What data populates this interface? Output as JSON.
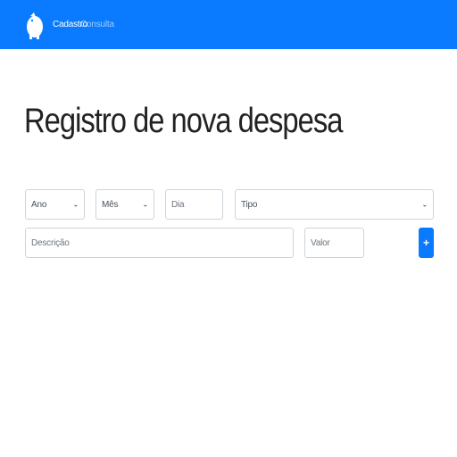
{
  "navbar": {
    "brand_icon": "piggy-bank-icon",
    "links": [
      {
        "label": "Cadastro",
        "active": true
      },
      {
        "label": "Consulta",
        "active": false
      }
    ],
    "background": "#0a7bff"
  },
  "main": {
    "title": "Registro de nova despesa"
  },
  "form": {
    "ano": {
      "value": "Ano"
    },
    "mes": {
      "value": "Mês"
    },
    "dia": {
      "placeholder": "Dia"
    },
    "tipo": {
      "value": "Tipo"
    },
    "descricao": {
      "placeholder": "Descrição"
    },
    "valor": {
      "placeholder": "Valor"
    },
    "add_button": {
      "icon": "plus-icon",
      "label": "+"
    }
  },
  "colors": {
    "primary": "#0a7bff",
    "border": "#ced4da",
    "placeholder": "#6c757d"
  }
}
